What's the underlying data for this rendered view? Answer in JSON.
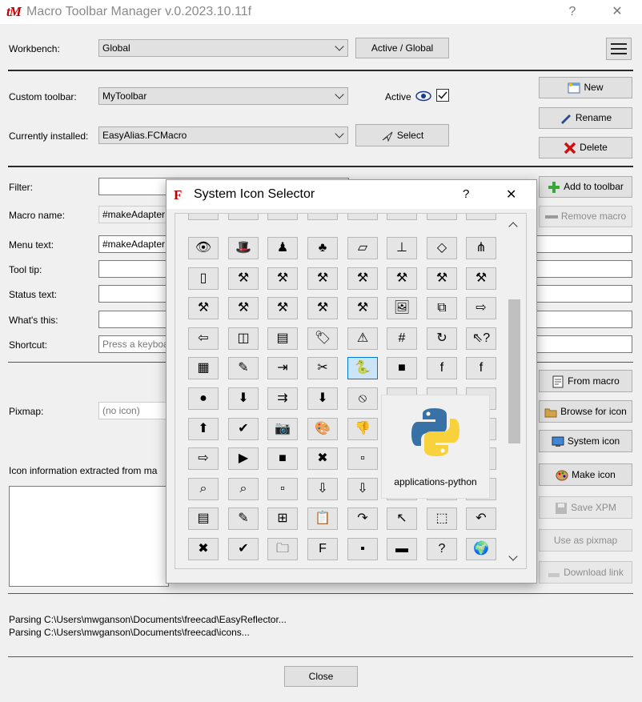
{
  "window": {
    "logo": "tM",
    "title": "Macro Toolbar Manager v.0.2023.10.11f",
    "help": "?",
    "close": "✕"
  },
  "workbench": {
    "label": "Workbench:",
    "value": "Global",
    "toggle_button": "Active / Global"
  },
  "custom_toolbar": {
    "label": "Custom toolbar:",
    "value": "MyToolbar",
    "active_label": "Active"
  },
  "installed": {
    "label": "Currently installed:",
    "value": "EasyAlias.FCMacro",
    "select_button": "Select"
  },
  "side_buttons": {
    "new": "New",
    "rename": "Rename",
    "delete": "Delete",
    "add_to_toolbar": "Add to toolbar",
    "remove_macro": "Remove macro",
    "from_macro": "From macro",
    "browse_for_icon": "Browse for icon",
    "system_icon": "System icon",
    "make_icon": "Make icon",
    "save_xpm": "Save XPM",
    "use_as_pixmap": "Use as pixmap",
    "download_link": "Download link"
  },
  "form": {
    "filter_label": "Filter:",
    "macro_name_label": "Macro name:",
    "macro_name_value": "#makeAdapter",
    "menu_text_label": "Menu text:",
    "menu_text_value": "#makeAdapter",
    "tool_tip_label": "Tool tip:",
    "status_text_label": "Status text:",
    "whats_this_label": "What's this:",
    "shortcut_label": "Shortcut:",
    "shortcut_placeholder": "Press a keyboard",
    "pixmap_label": "Pixmap:",
    "pixmap_placeholder": "(no icon)",
    "icon_info_label": "Icon information extracted from ma"
  },
  "log": [
    "Parsing C:\\Users\\mwganson\\Documents\\freecad\\EasyReflector...",
    "Parsing C:\\Users\\mwganson\\Documents\\freecad\\icons..."
  ],
  "close_button": "Close",
  "dialog": {
    "title": "System Icon Selector",
    "help": "?",
    "close": "✕",
    "preview_label": "applications-python",
    "icons": [
      [
        "👁",
        "🎩",
        "♟",
        "♣",
        "▱",
        "⊥",
        "◇",
        "⋔"
      ],
      [
        "▯",
        "⚒",
        "⚒",
        "⚒",
        "⚒",
        "⚒",
        "⚒",
        "⚒"
      ],
      [
        "⚒",
        "⚒",
        "⚒",
        "⚒",
        "⚒",
        "🖼",
        "⧉",
        "⇨"
      ],
      [
        "⇦",
        "◫",
        "▤",
        "🏷",
        "⚠",
        "#",
        "↻",
        "⇖?"
      ],
      [
        "▦",
        "✎",
        "⇥",
        "✂",
        "🐍",
        "■",
        "f",
        "f"
      ],
      [
        "●",
        "⬇",
        "⇉",
        "⬇",
        "⦸",
        "",
        "",
        ""
      ],
      [
        "⬆",
        "✔",
        "📷",
        "🎨",
        "👎",
        "",
        "",
        ""
      ],
      [
        "⇨",
        "▶",
        "■",
        "✖",
        "▫",
        "",
        "",
        ""
      ],
      [
        "⌕",
        "⌕",
        "▫",
        "⇩",
        "⇩",
        "",
        "",
        ""
      ],
      [
        "▤",
        "✎",
        "⊞",
        "📋",
        "↷",
        "↖",
        "⬚",
        "↶"
      ],
      [
        "✖",
        "✔",
        "🗀",
        "F",
        "▪",
        "▬",
        "?",
        "🌍"
      ]
    ]
  },
  "colors": {
    "accent": "#0078d7",
    "red": "#c00000"
  }
}
